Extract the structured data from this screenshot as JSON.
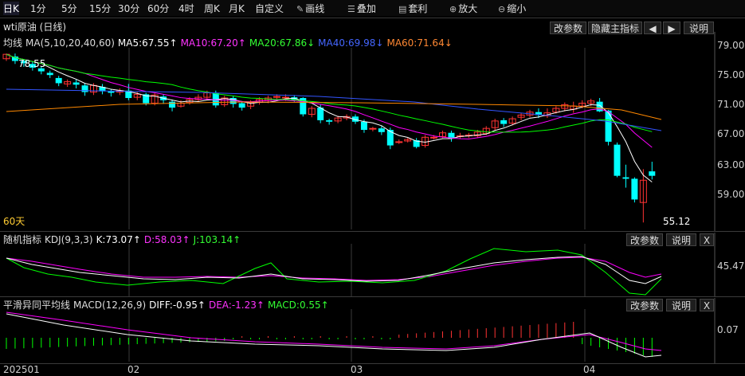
{
  "toolbar": {
    "periods": [
      "日K",
      "1分",
      "5分",
      "15分",
      "30分",
      "60分",
      "4时",
      "周K",
      "月K",
      "自定义"
    ],
    "active_period": "日K",
    "tools": [
      {
        "icon": "pencil-icon",
        "label": "画线"
      },
      {
        "icon": "layers-icon",
        "label": "叠加"
      },
      {
        "icon": "arbitrage-icon",
        "label": "套利"
      },
      {
        "icon": "zoom-in-icon",
        "label": "放大"
      },
      {
        "icon": "zoom-out-icon",
        "label": "缩小"
      }
    ]
  },
  "main": {
    "title": "wti原油 (日线)",
    "buttons": {
      "params": "改参数",
      "hide": "隐藏主指标",
      "left": "◀",
      "right": "▶",
      "help": "说明"
    },
    "ma_label": "均线",
    "ma_params": "MA(5,10,20,40,60)",
    "ma5": "MA5:67.55↑",
    "ma10": "MA10:67.20↑",
    "ma20": "MA20:67.86↓",
    "ma40": "MA40:69.98↓",
    "ma60": "MA60:71.64↓",
    "high_label": "78.55",
    "low_label": "55.12",
    "days_label": "60天",
    "y_ticks": [
      "79.00",
      "75.00",
      "71.00",
      "67.00",
      "63.00",
      "59.00"
    ]
  },
  "kdj": {
    "title": "随机指标",
    "params": "KDJ(9,3,3)",
    "k": "K:73.07↑",
    "d": "D:58.03↑",
    "j": "J:103.14↑",
    "buttons": {
      "params": "改参数",
      "help": "说明",
      "close": "X"
    },
    "y_tick": "45.47"
  },
  "macd": {
    "title": "平滑异同平均线",
    "params": "MACD(12,26,9)",
    "diff": "DIFF:-0.95↑",
    "dea": "DEA:-1.23↑",
    "macd": "MACD:0.55↑",
    "buttons": {
      "params": "改参数",
      "help": "说明",
      "close": "X"
    },
    "y_tick": "0.07"
  },
  "x_axis": {
    "labels": [
      "202501",
      "02",
      "03",
      "04"
    ]
  },
  "colors": {
    "up": "#ff3333",
    "down": "#00ffff",
    "ma5": "#ffffff",
    "ma10": "#ff00ff",
    "ma20": "#00ff00",
    "ma40": "#3355ff",
    "ma60": "#ff8800",
    "k": "#ffffff",
    "d": "#ff00ff",
    "j": "#00ff00"
  },
  "chart_data": {
    "type": "candlestick",
    "ylim": [
      55.12,
      78.55
    ],
    "candles": [
      [
        77.2,
        77.8,
        76.9,
        77.9
      ],
      [
        77.5,
        76.9,
        76.5,
        77.9
      ],
      [
        76.9,
        76.6,
        76.1,
        77.1
      ],
      [
        76.5,
        76.0,
        75.6,
        76.8
      ],
      [
        75.9,
        75.5,
        75.1,
        76.2
      ],
      [
        75.3,
        75.0,
        74.6,
        75.6
      ],
      [
        74.6,
        73.9,
        73.5,
        74.9
      ],
      [
        73.8,
        74.1,
        73.4,
        74.4
      ],
      [
        74.0,
        73.7,
        73.2,
        74.4
      ],
      [
        73.6,
        72.7,
        72.2,
        73.9
      ],
      [
        72.7,
        73.6,
        72.3,
        73.9
      ],
      [
        73.4,
        72.8,
        72.4,
        73.8
      ],
      [
        72.8,
        72.6,
        72.1,
        73.1
      ],
      [
        72.7,
        72.9,
        72.3,
        73.2
      ],
      [
        72.9,
        71.9,
        71.6,
        73.8
      ],
      [
        72.0,
        72.4,
        71.6,
        72.7
      ],
      [
        72.4,
        71.2,
        70.9,
        72.6
      ],
      [
        71.2,
        72.3,
        70.9,
        72.6
      ],
      [
        72.1,
        71.6,
        71.1,
        72.4
      ],
      [
        71.4,
        70.6,
        70.1,
        71.7
      ],
      [
        70.8,
        71.2,
        70.6,
        71.6
      ],
      [
        71.3,
        71.7,
        71.0,
        72.0
      ],
      [
        71.7,
        72.0,
        71.4,
        72.4
      ],
      [
        72.0,
        72.6,
        71.6,
        72.9
      ],
      [
        72.6,
        70.9,
        70.6,
        72.9
      ],
      [
        71.0,
        71.9,
        70.7,
        72.2
      ],
      [
        71.9,
        71.1,
        70.6,
        72.2
      ],
      [
        71.2,
        70.6,
        70.2,
        71.5
      ],
      [
        70.8,
        71.3,
        70.4,
        71.6
      ],
      [
        71.3,
        71.7,
        71.0,
        72.0
      ],
      [
        71.6,
        71.9,
        71.2,
        72.2
      ],
      [
        72.0,
        72.1,
        71.6,
        72.4
      ],
      [
        71.9,
        72.0,
        71.5,
        72.4
      ],
      [
        72.0,
        71.7,
        71.4,
        72.3
      ],
      [
        71.9,
        69.7,
        69.4,
        72.0
      ],
      [
        69.7,
        70.5,
        69.3,
        70.8
      ],
      [
        70.6,
        68.9,
        68.5,
        71.0
      ],
      [
        68.9,
        68.7,
        68.3,
        69.1
      ],
      [
        68.8,
        69.2,
        68.5,
        69.5
      ],
      [
        69.2,
        69.4,
        68.9,
        69.7
      ],
      [
        69.4,
        68.7,
        68.4,
        69.7
      ],
      [
        68.7,
        67.6,
        67.2,
        69.0
      ],
      [
        67.7,
        67.8,
        67.4,
        68.0
      ],
      [
        67.8,
        67.3,
        66.9,
        68.1
      ],
      [
        67.6,
        65.5,
        65.0,
        67.9
      ],
      [
        66.0,
        66.0,
        65.7,
        66.3
      ],
      [
        66.1,
        66.3,
        65.9,
        66.5
      ],
      [
        66.2,
        65.3,
        65.1,
        66.5
      ],
      [
        65.5,
        66.6,
        65.2,
        66.9
      ],
      [
        66.6,
        66.6,
        66.3,
        66.9
      ],
      [
        66.7,
        67.2,
        66.5,
        67.5
      ],
      [
        67.2,
        66.4,
        66.0,
        67.5
      ],
      [
        66.7,
        66.8,
        66.4,
        67.2
      ],
      [
        66.8,
        66.9,
        66.5,
        67.2
      ],
      [
        66.8,
        67.3,
        66.5,
        67.6
      ],
      [
        67.1,
        67.8,
        66.9,
        68.1
      ],
      [
        67.9,
        68.8,
        67.5,
        69.1
      ],
      [
        68.9,
        68.4,
        68.0,
        69.2
      ],
      [
        68.5,
        69.1,
        68.2,
        69.4
      ],
      [
        69.3,
        69.6,
        68.9,
        69.9
      ],
      [
        69.6,
        70.0,
        69.3,
        70.3
      ],
      [
        70.0,
        69.6,
        69.2,
        70.5
      ],
      [
        69.5,
        69.9,
        69.2,
        70.5
      ],
      [
        70.0,
        70.5,
        69.8,
        70.8
      ],
      [
        70.5,
        71.0,
        70.1,
        71.3
      ],
      [
        70.4,
        70.8,
        69.9,
        71.4
      ],
      [
        70.8,
        71.2,
        70.5,
        71.6
      ],
      [
        71.2,
        71.5,
        70.8,
        71.8
      ],
      [
        71.4,
        70.1,
        70.0,
        71.9
      ],
      [
        70.2,
        66.0,
        65.5,
        70.3
      ],
      [
        65.6,
        61.4,
        61.2,
        65.9
      ],
      [
        61.2,
        61.0,
        59.8,
        62.9
      ],
      [
        61.0,
        58.2,
        57.8,
        61.2
      ],
      [
        57.8,
        60.8,
        55.1,
        62.3
      ],
      [
        62.0,
        61.4,
        60.9,
        63.3
      ]
    ]
  }
}
